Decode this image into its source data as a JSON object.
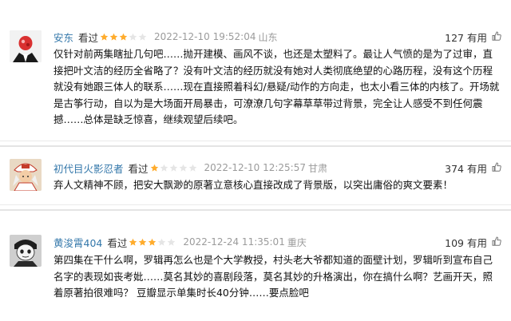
{
  "reviews": [
    {
      "username": "安东",
      "action": "看过",
      "rating": 3,
      "time": "2022-12-10 19:52:04",
      "location": "山东",
      "votes": "127 有用",
      "content": "仅针对前两集瞎扯几句吧……抛开建模、画风不谈，也还是太塑料了。最让人气愤的是为了过审，直接把叶文洁的经历全省略了？没有叶文洁的经历就没有她对人类彻底绝望的心路历程，没有这个历程就没有她跟三体人的联系……现在直接照着科幻/悬疑/动作的方向走，也太小看三体的内核了。开场就是古筝行动，自以为是大场面开局暴击，可潦潦几句字幕草草带过背景，完全让人感受不到任何震撼……总体是缺乏惊喜，继续观望后续吧。"
    },
    {
      "username": "初代目火影忍者",
      "action": "看过",
      "rating": 1,
      "time": "2022-12-10 12:25:57",
      "location": "甘肃",
      "votes": "374 有用",
      "content": "弃人文精神不顾，把安大飘渺的原著立意核心直接改成了背景版，以突出庸俗的爽文要素！"
    },
    {
      "username": "黄浚霄404",
      "action": "看过",
      "rating": 3,
      "time": "2022-12-24 11:35:01",
      "location": "重庆",
      "votes": "109 有用",
      "content": "第四集在干什么啊，罗辑再怎么也是个大学教授，村头老大爷都知道的面壁计划，罗辑听到宣布自己名字的表现如丧考妣……莫名其妙的喜剧段落，莫名其妙的升格演出，你在搞什么啊？艺画开天，照着原著拍很难吗？ 豆瓣显示单集时长40分钟……要点脸吧"
    }
  ],
  "colors": {
    "username": "#3377aa",
    "star_filled": "#ffac2d",
    "star_empty": "#e5e5e5",
    "meta_gray": "#9b9b9b"
  },
  "icons": {
    "vote": "thumbs-up-icon",
    "star": "star-icon"
  }
}
